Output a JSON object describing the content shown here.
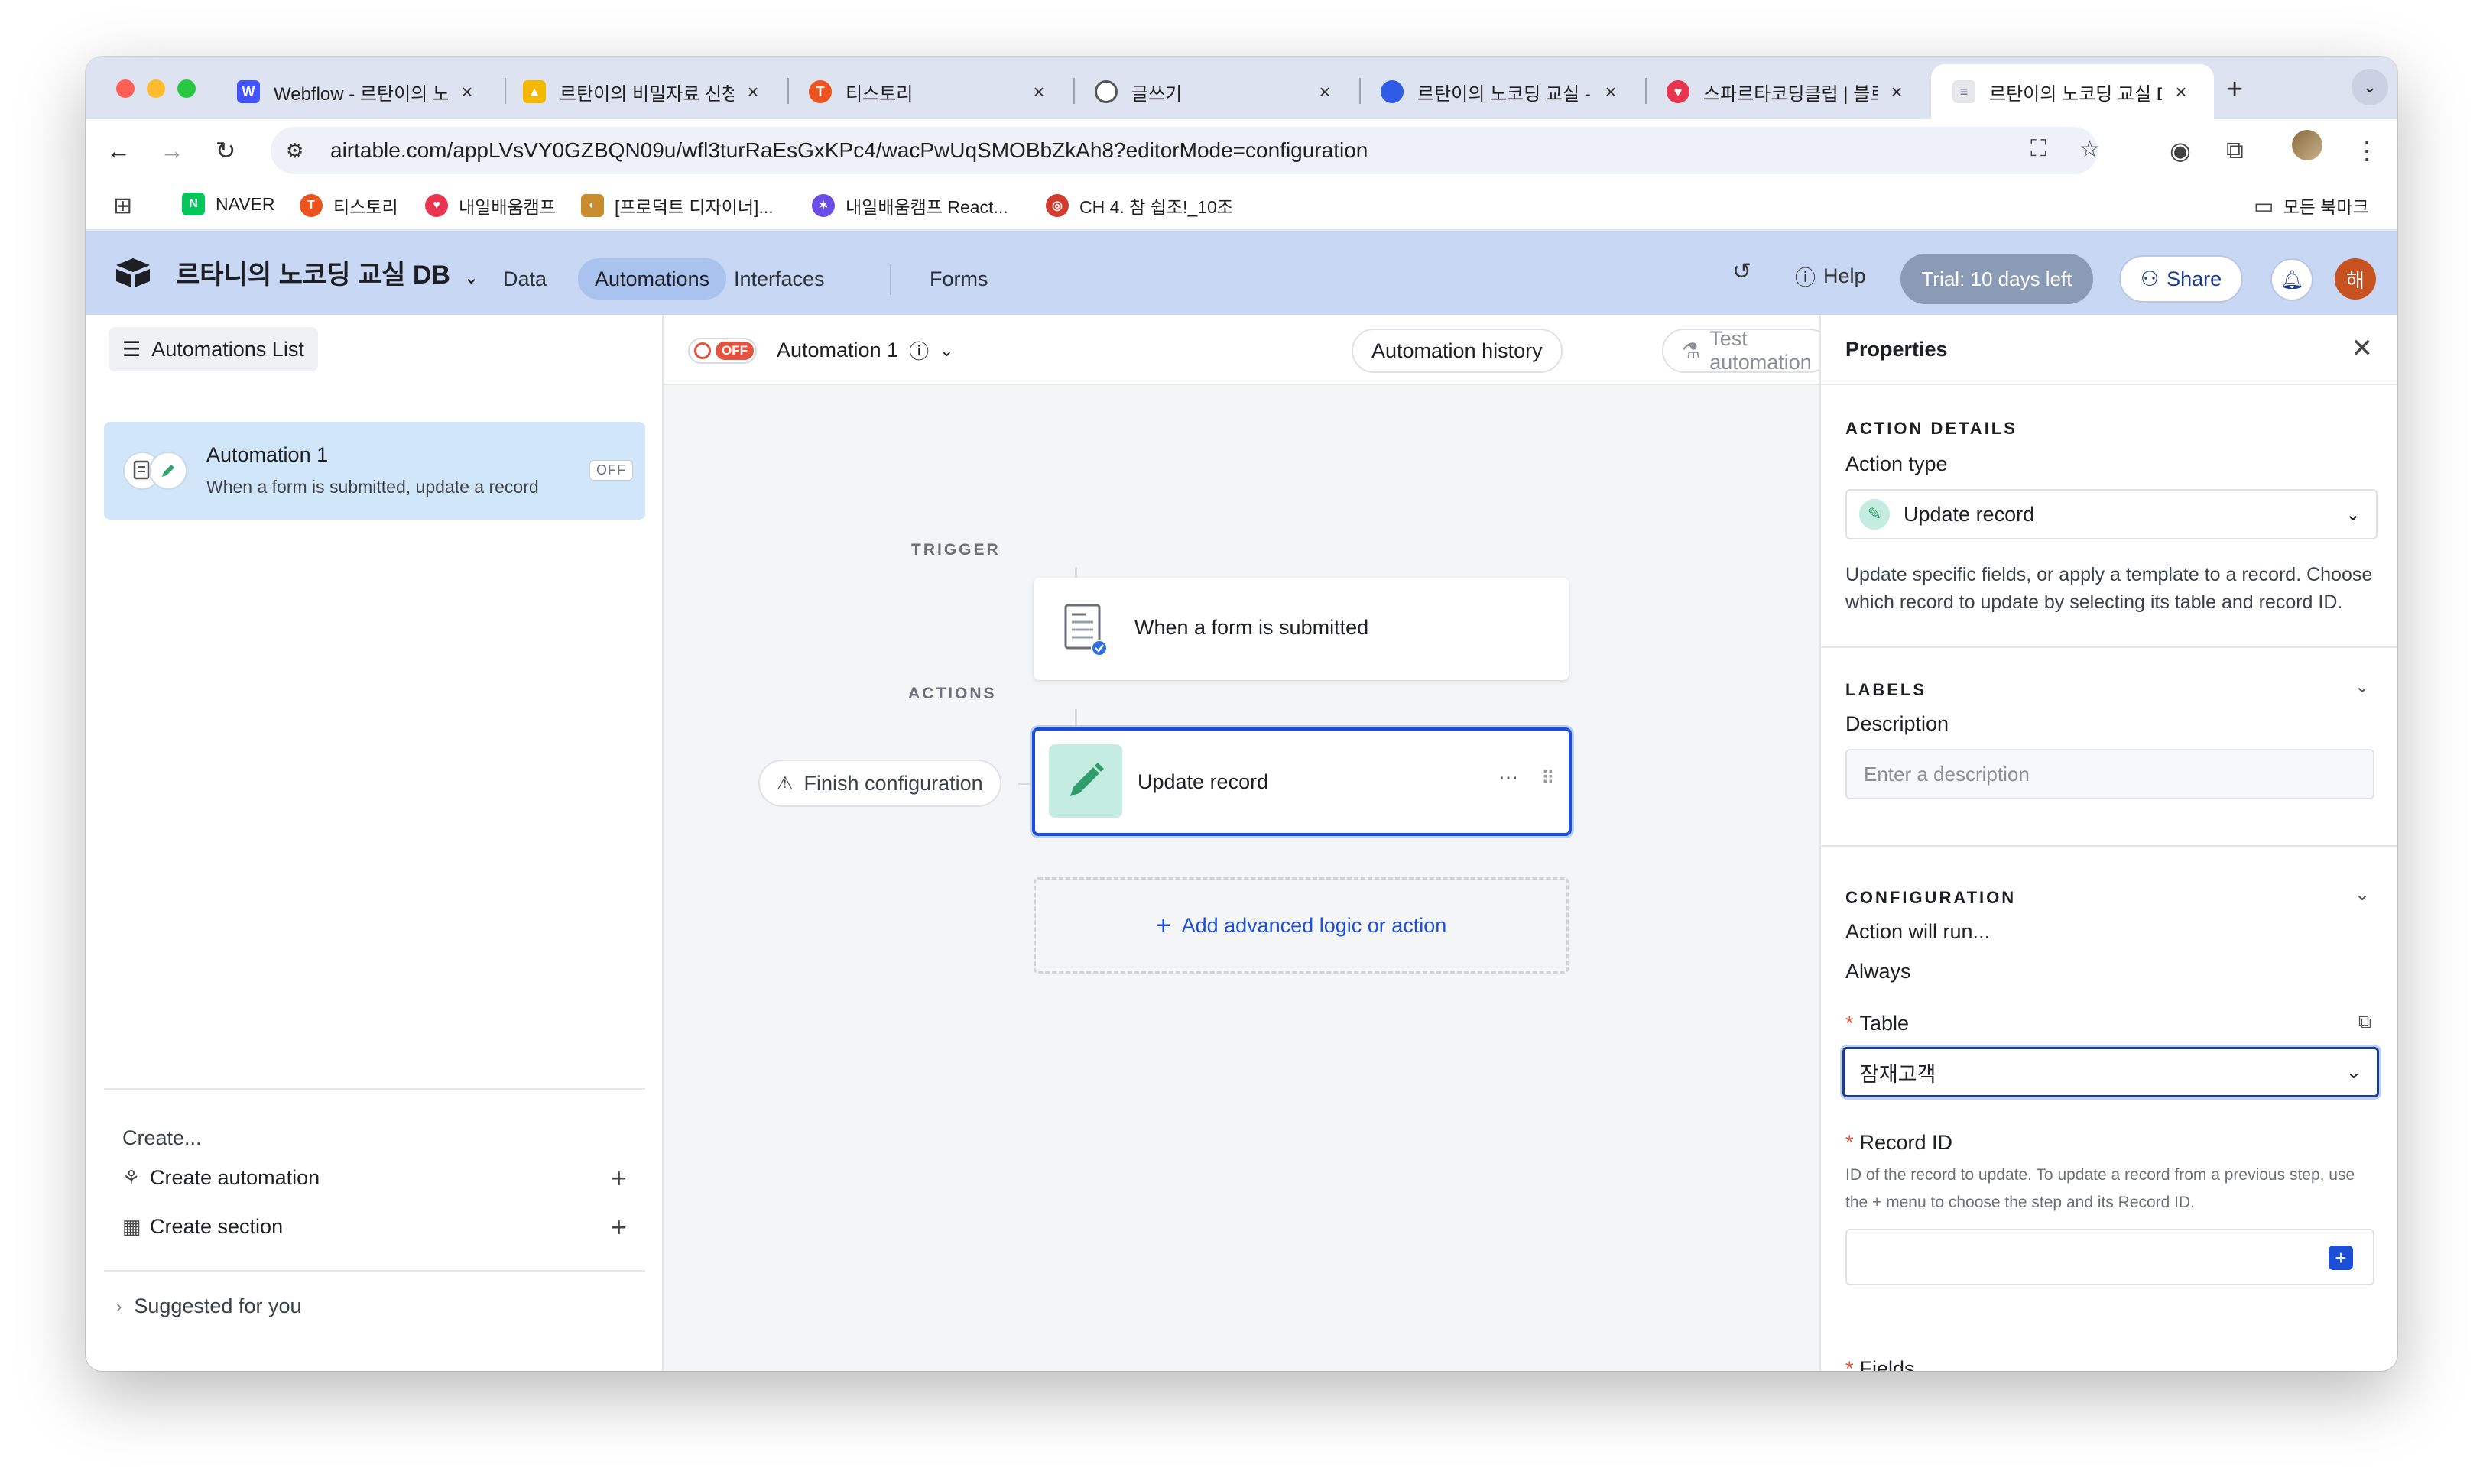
{
  "browser": {
    "tabs": [
      {
        "label": "Webflow - 르탄이의 노",
        "favicon": "webflow-icon",
        "color": "#4353ff"
      },
      {
        "label": "르탄이의 비밀자료 신청",
        "favicon": "airtable-icon",
        "color": "#f5b800"
      },
      {
        "label": "티스토리",
        "favicon": "tistory-icon",
        "color": "#eb531f"
      },
      {
        "label": "글쓰기",
        "favicon": "globe-icon",
        "color": "#555555"
      },
      {
        "label": "르탄이의 노코딩 교실 -",
        "favicon": "blue-circle-icon",
        "color": "#2f5be7"
      },
      {
        "label": "스파르타코딩클럽 | 블로",
        "favicon": "sparta-icon",
        "color": "#e8344e"
      },
      {
        "label": "르탄이의 노코딩 교실 DB",
        "favicon": "doc-icon",
        "color": "#6b7280",
        "active": true
      }
    ],
    "url": "airtable.com/appLVsVY0GZBQN09u/wfl3turRaEsGxKPc4/wacPwUqSMOBbZkAh8?editorMode=configuration",
    "bookmarks": [
      {
        "label": "NAVER",
        "icon": "naver-icon",
        "color": "#03c75a"
      },
      {
        "label": "티스토리",
        "icon": "tistory-icon",
        "color": "#eb531f"
      },
      {
        "label": "내일배움캠프",
        "icon": "heart-code-icon",
        "color": "#e8344e"
      },
      {
        "label": "[프로덕트 디자이너]...",
        "icon": "palette-icon",
        "color": "#c98b2e"
      },
      {
        "label": "내일배움캠프 React...",
        "icon": "react-icon",
        "color": "#6b4ce6"
      },
      {
        "label": "CH 4. 참 쉽조!_10조",
        "icon": "target-icon",
        "color": "#d43b2f"
      }
    ],
    "all_bookmarks": "모든 북마크"
  },
  "app": {
    "base_name": "르타니의 노코딩 교실 DB",
    "nav": {
      "data": "Data",
      "automations": "Automations",
      "interfaces": "Interfaces",
      "forms": "Forms"
    },
    "help": "Help",
    "trial": "Trial: 10 days left",
    "share": "Share",
    "user_initial": "해"
  },
  "left": {
    "list_button": "Automations List",
    "automation": {
      "name": "Automation 1",
      "desc": "When a form is submitted, update a record",
      "status": "OFF"
    },
    "create_label": "Create...",
    "create_automation": "Create automation",
    "create_section": "Create section",
    "suggested": "Suggested for you"
  },
  "center": {
    "toggle": "OFF",
    "automation_name": "Automation 1",
    "history_button": "Automation history",
    "test_button": "Test automation",
    "trigger_label": "TRIGGER",
    "actions_label": "ACTIONS",
    "trigger_card": "When a form is submitted",
    "action_card": "Update record",
    "finish_config": "Finish configuration",
    "add_logic": "Add advanced logic or action"
  },
  "properties": {
    "title": "Properties",
    "action_details": "ACTION DETAILS",
    "action_type_label": "Action type",
    "action_type_value": "Update record",
    "action_desc": "Update specific fields, or apply a template to a record. Choose which record to update by selecting its table and record ID.",
    "labels_section": "LABELS",
    "description_label": "Description",
    "description_placeholder": "Enter a description",
    "configuration": "CONFIGURATION",
    "action_will_run": "Action will run...",
    "always": "Always",
    "table_label": "Table",
    "table_value": "잠재고객",
    "record_id_label": "Record ID",
    "record_id_help": "ID of the record to update. To update a record from a previous step, use the + menu to choose the step and its Record ID.",
    "fields_label": "Fields"
  }
}
